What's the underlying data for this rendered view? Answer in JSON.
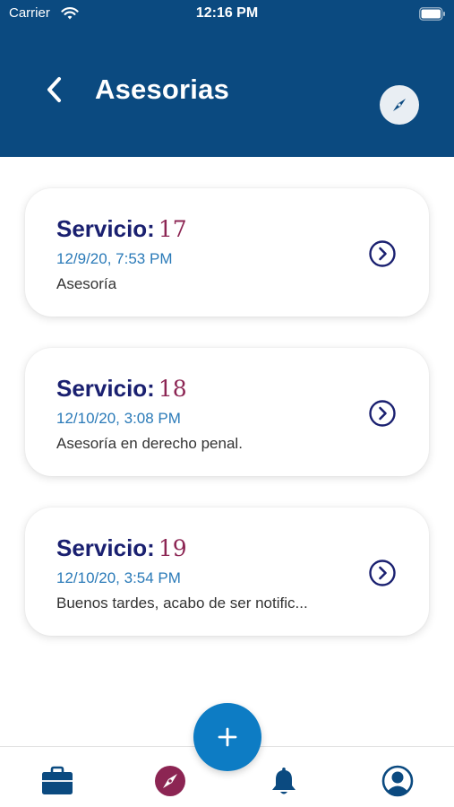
{
  "status_bar": {
    "carrier": "Carrier",
    "time": "12:16 PM"
  },
  "header": {
    "title": "Asesorias",
    "back_icon": "chevron-left-icon",
    "compass_icon": "compass-icon"
  },
  "cards": [
    {
      "label": "Servicio:",
      "number": "17",
      "date": "12/9/20, 7:53 PM",
      "description": "Asesoría"
    },
    {
      "label": "Servicio:",
      "number": "18",
      "date": "12/10/20, 3:08 PM",
      "description": "Asesoría en derecho penal."
    },
    {
      "label": "Servicio:",
      "number": "19",
      "date": "12/10/20, 3:54 PM",
      "description": "Buenos tardes, acabo de ser notific..."
    }
  ],
  "fab": {
    "icon": "plus-icon"
  },
  "tabbar": {
    "tabs": [
      {
        "name": "briefcase",
        "icon": "briefcase-icon"
      },
      {
        "name": "compass",
        "icon": "compass-icon",
        "active": true
      },
      {
        "name": "notifications",
        "icon": "bell-icon"
      },
      {
        "name": "profile",
        "icon": "user-icon"
      }
    ]
  },
  "colors": {
    "header_bg": "#0b4a80",
    "title_navy": "#1a2070",
    "number_maroon": "#8c2553",
    "date_blue": "#2a7ab8",
    "fab_blue": "#0d7cc4",
    "tab_icon": "#0b4a80",
    "tab_active": "#8c2553"
  }
}
